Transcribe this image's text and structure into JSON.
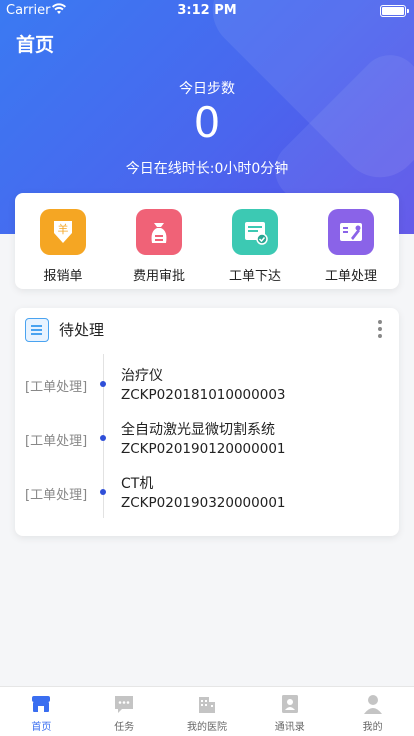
{
  "status_bar": {
    "carrier": "Carrier",
    "time": "3:12 PM"
  },
  "header": {
    "title": "首页",
    "steps_label": "今日步数",
    "steps_value": "0",
    "online_time": "今日在线时长:0小时0分钟"
  },
  "quick_actions": [
    {
      "label": "报销单",
      "icon": "yuan-shield-icon",
      "color": "#f5a623"
    },
    {
      "label": "费用审批",
      "icon": "money-bag-icon",
      "color": "#f06277"
    },
    {
      "label": "工单下达",
      "icon": "document-check-icon",
      "color": "#3cc9b3"
    },
    {
      "label": "工单处理",
      "icon": "tools-icon",
      "color": "#8a63e8"
    }
  ],
  "todo": {
    "title": "待处理",
    "items": [
      {
        "type": "[工单处理]",
        "name": "治疗仪",
        "code": "ZCKP020181010000003"
      },
      {
        "type": "[工单处理]",
        "name": "全自动激光显微切割系统",
        "code": "ZCKP020190120000001"
      },
      {
        "type": "[工单处理]",
        "name": "CT机",
        "code": "ZCKP020190320000001"
      }
    ]
  },
  "tabbar": [
    {
      "label": "首页",
      "icon": "store-icon",
      "active": true
    },
    {
      "label": "任务",
      "icon": "chat-icon",
      "active": false
    },
    {
      "label": "我的医院",
      "icon": "building-icon",
      "active": false
    },
    {
      "label": "通讯录",
      "icon": "contacts-icon",
      "active": false
    },
    {
      "label": "我的",
      "icon": "person-icon",
      "active": false
    }
  ],
  "colors": {
    "primary": "#3a6ef0",
    "tab_inactive": "#c4c4c4"
  }
}
